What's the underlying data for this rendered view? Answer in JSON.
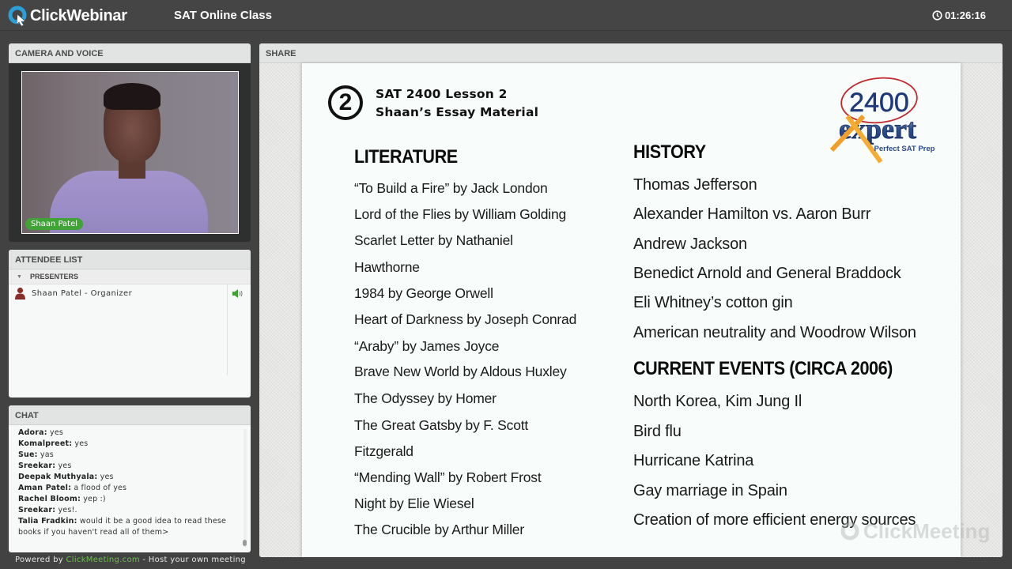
{
  "topbar": {
    "brand": "ClickWebinar",
    "title": "SAT Online Class",
    "timer": "01:26:16"
  },
  "camera": {
    "header": "CAMERA AND VOICE",
    "presenter_tag": "Shaan Patel"
  },
  "attendees": {
    "header": "ATTENDEE LIST",
    "group": "PRESENTERS",
    "rows": [
      {
        "name": "Shaan Patel - Organizer"
      }
    ]
  },
  "chat": {
    "header": "CHAT",
    "messages": [
      {
        "sender": "Adora:",
        "text": " yes"
      },
      {
        "sender": "Komalpreet:",
        "text": " yes"
      },
      {
        "sender": "Sue:",
        "text": " yas"
      },
      {
        "sender": "Sreekar:",
        "text": " yes"
      },
      {
        "sender": "Deepak Muthyala:",
        "text": " yes"
      },
      {
        "sender": "Aman Patel:",
        "text": " a flood of yes"
      },
      {
        "sender": "Rachel Bloom:",
        "text": " yep :)"
      },
      {
        "sender": "Sreekar:",
        "text": " yes!."
      },
      {
        "sender": "Talia Fradkin:",
        "text": " would it be a good idea to read these books if you haven't read all of them>"
      }
    ]
  },
  "footer": {
    "powered_prefix": "Powered by ",
    "powered_link": "ClickMeeting.com",
    "powered_suffix": " - Host your own meeting"
  },
  "share": {
    "header": "SHARE",
    "slide": {
      "number": "2",
      "title_line1": "SAT 2400 Lesson 2",
      "title_line2": "Shaan’s Essay Material",
      "logo_top": "2400",
      "logo_word": "expert",
      "logo_tagline": "Perfect SAT Prep",
      "literature": {
        "heading": "LITERATURE",
        "items": [
          "“To Build a Fire” by Jack London",
          "Lord of the Flies by William Golding",
          "Scarlet Letter by Nathaniel",
          "Hawthorne",
          "1984 by George Orwell",
          "Heart of Darkness by Joseph Conrad",
          "“Araby” by James Joyce",
          "Brave New World by Aldous Huxley",
          "The Odyssey by Homer",
          "The Great Gatsby by F. Scott",
          "Fitzgerald",
          "“Mending Wall” by Robert Frost",
          "Night by Elie Wiesel",
          "The Crucible by Arthur Miller"
        ]
      },
      "history": {
        "heading": "HISTORY",
        "items": [
          "Thomas Jefferson",
          "Alexander Hamilton vs. Aaron Burr",
          "Andrew Jackson",
          "Benedict Arnold and General Braddock",
          "Eli Whitney’s cotton gin",
          "American neutrality and Woodrow Wilson"
        ]
      },
      "current_events": {
        "heading": "CURRENT EVENTS (CIRCA 2006)",
        "items": [
          "North Korea, Kim Jung Il",
          "Bird flu",
          "Hurricane Katrina",
          "Gay marriage in Spain",
          "Creation of more efficient energy sources"
        ]
      },
      "watermark": "ClickMeeting"
    }
  },
  "colors": {
    "accent_green": "#3fa336",
    "link_green": "#6cc048",
    "brand_blue": "#2a9fd8",
    "topbar_bg": "#454545"
  }
}
